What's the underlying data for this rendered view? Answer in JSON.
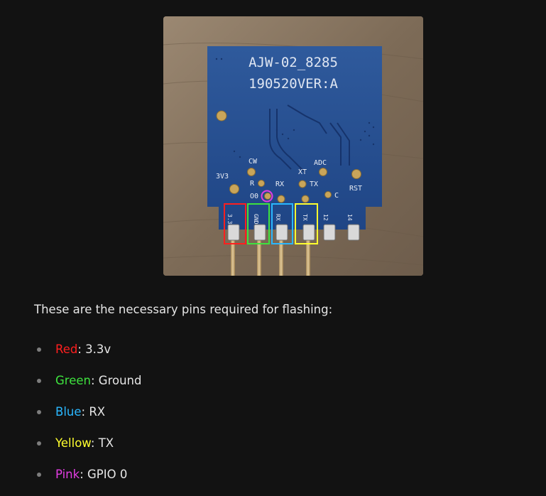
{
  "photo": {
    "board_line1": "AJW-02_8285",
    "board_line2": "190520VER:A",
    "silk_cw": "CW",
    "silk_3v3": "3V3",
    "silk_r": "R",
    "silk_rx": "RX",
    "silk_xt": "XT",
    "silk_adc": "ADC",
    "silk_tx": "TX",
    "silk_rst": "RST",
    "silk_c": "C",
    "silk_o0": "O0",
    "pin_labels": [
      "3.3",
      "GND",
      "RX",
      "TX",
      "12",
      "14"
    ]
  },
  "intro_text": "These are the necessary pins required for flashing:",
  "pins": [
    {
      "color_name": "Red",
      "value": "3.3v",
      "color": "#ff1f1f"
    },
    {
      "color_name": "Green",
      "value": "Ground",
      "color": "#3ee23e"
    },
    {
      "color_name": "Blue",
      "value": "RX",
      "color": "#2ab7ff"
    },
    {
      "color_name": "Yellow",
      "value": "TX",
      "color": "#ffff2e"
    },
    {
      "color_name": "Pink",
      "value": "GPIO 0",
      "color": "#e23de2"
    }
  ],
  "separator": ":"
}
